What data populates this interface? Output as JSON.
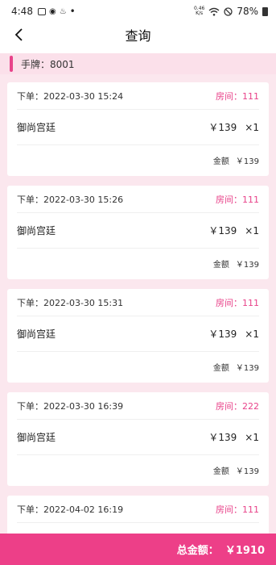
{
  "status_bar": {
    "time": "4:48",
    "net_speed_top": "0.46",
    "net_speed_bottom": "K/s",
    "battery": "78%"
  },
  "navbar": {
    "title": "查询"
  },
  "hand": {
    "label": "手牌：8001"
  },
  "orders": [
    {
      "order_time": "下单：2022-03-30 15:24",
      "room": "房间：111",
      "item": "御尚宫廷",
      "price": "￥139",
      "qty": "×1",
      "amount_label": "金额",
      "amount": "￥139"
    },
    {
      "order_time": "下单：2022-03-30 15:26",
      "room": "房间：111",
      "item": "御尚宫廷",
      "price": "￥139",
      "qty": "×1",
      "amount_label": "金额",
      "amount": "￥139"
    },
    {
      "order_time": "下单：2022-03-30 15:31",
      "room": "房间：111",
      "item": "御尚宫廷",
      "price": "￥139",
      "qty": "×1",
      "amount_label": "金额",
      "amount": "￥139"
    },
    {
      "order_time": "下单：2022-03-30 16:39",
      "room": "房间：222",
      "item": "御尚宫廷",
      "price": "￥139",
      "qty": "×1",
      "amount_label": "金额",
      "amount": "￥139"
    },
    {
      "order_time": "下单：2022-04-02 16:19",
      "room": "房间：111"
    }
  ],
  "footer": {
    "total_label": "总金额：",
    "total_value": "￥1910"
  },
  "colors": {
    "accent": "#e8438a",
    "footer": "#ed3f88",
    "background": "#fbe7ee"
  }
}
